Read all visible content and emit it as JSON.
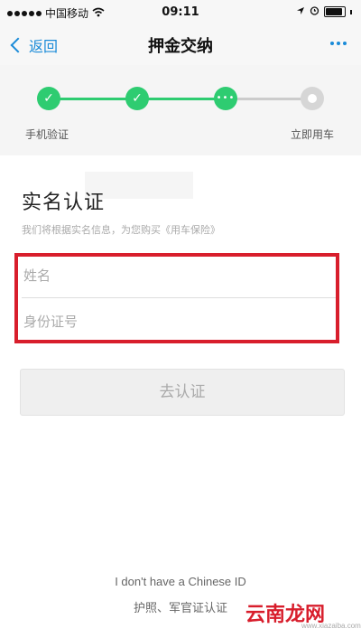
{
  "status_bar": {
    "carrier": "中国移动",
    "time": "09:11"
  },
  "nav": {
    "back_label": "返回",
    "title": "押金交纳"
  },
  "steps": {
    "labels": [
      "手机验证",
      "立即用车"
    ],
    "done_mark": "✓",
    "current_mark": "•••"
  },
  "form": {
    "title": "实名认证",
    "subtitle": "我们将根据实名信息，为您购买《用车保险》",
    "name_placeholder": "姓名",
    "id_placeholder": "身份证号",
    "submit_label": "去认证"
  },
  "footer": {
    "no_id_text": "I don't have a Chinese ID",
    "alt_text": "护照、军官证认证"
  },
  "watermark": {
    "text": "云南龙网",
    "url": "www.xiazaiba.com"
  },
  "colors": {
    "accent": "#1a8bd8",
    "step_done": "#2ecc71",
    "highlight_border": "#d81e2c"
  }
}
